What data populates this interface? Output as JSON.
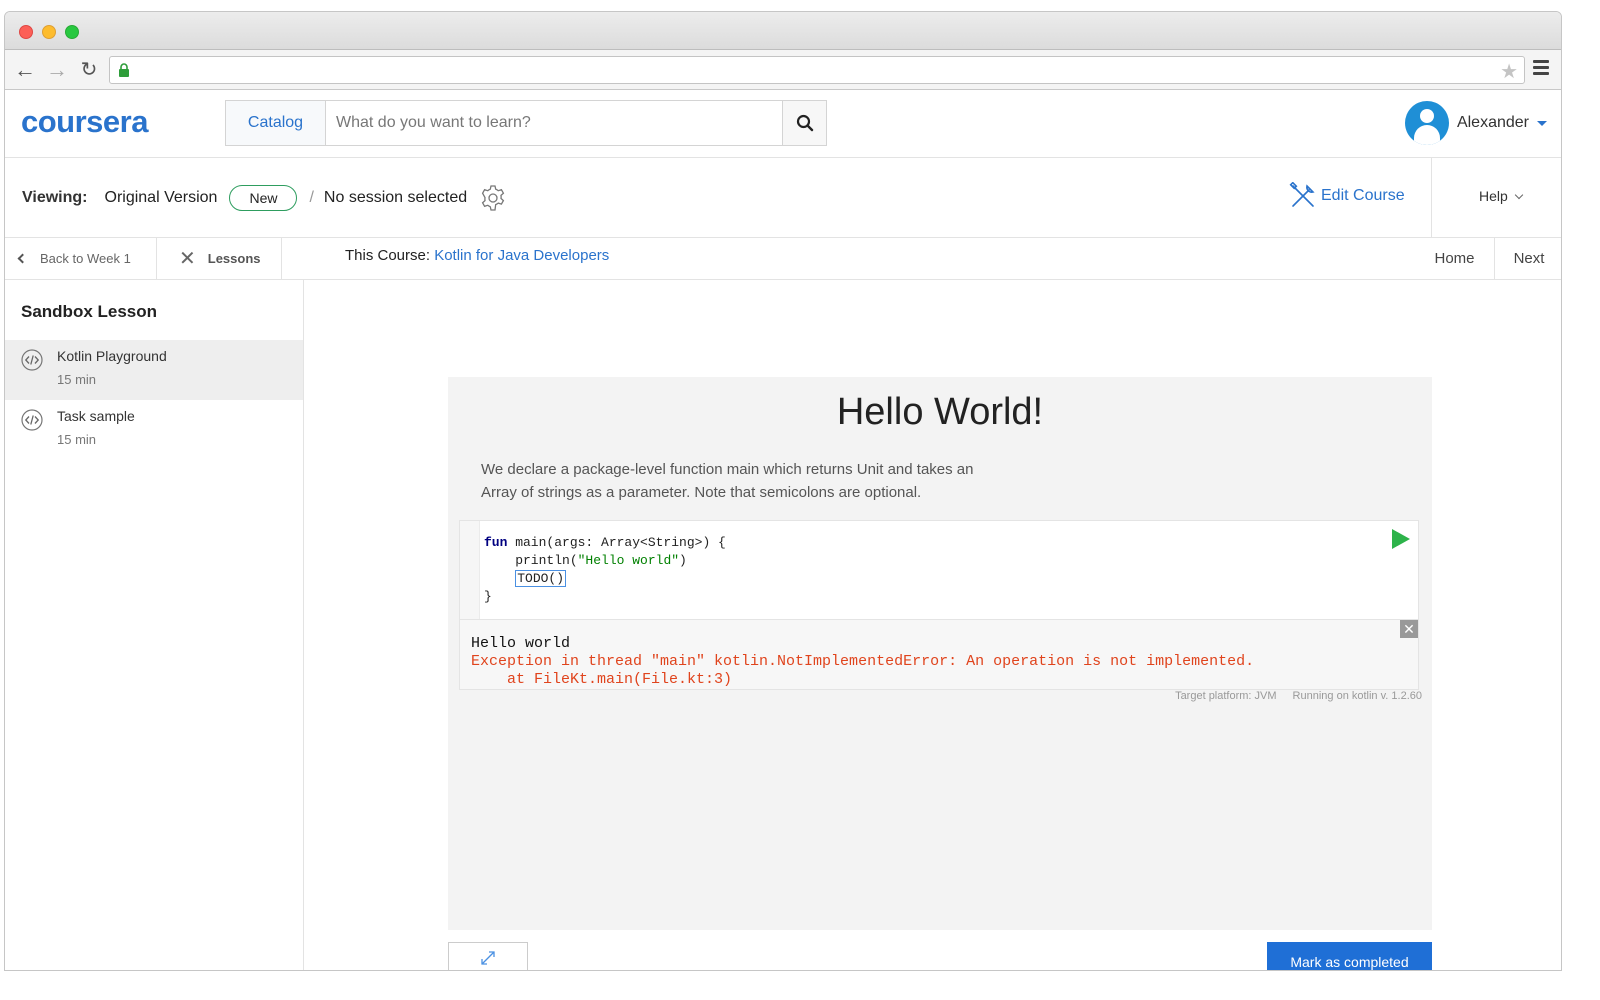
{
  "browser": {
    "url": ""
  },
  "header": {
    "logo": "coursera",
    "catalog_label": "Catalog",
    "search_placeholder": "What do you want to learn?",
    "user_name": "Alexander"
  },
  "viewing_bar": {
    "label": "Viewing:",
    "version": "Original Version",
    "new_badge": "New",
    "separator": "/",
    "session": "No session selected",
    "edit_course": "Edit Course",
    "help": "Help"
  },
  "lesson_nav": {
    "back": "Back to Week 1",
    "lessons": "Lessons",
    "course_prefix": "This Course:",
    "course_name": "Kotlin for Java Developers",
    "home": "Home",
    "next": "Next"
  },
  "sidebar": {
    "title": "Sandbox Lesson",
    "items": [
      {
        "name": "Kotlin Playground",
        "duration": "15 min",
        "active": true
      },
      {
        "name": "Task sample",
        "duration": "15 min",
        "active": false
      }
    ]
  },
  "lesson": {
    "title": "Hello World!",
    "description": "We declare a package-level function main which returns Unit and takes an Array of strings as a parameter. Note that semicolons are optional.",
    "code": {
      "line1_kw": "fun",
      "line1_rest": " main(args: Array<String>) {",
      "line2_pre": "    println(",
      "line2_str": "\"Hello world\"",
      "line2_post": ")",
      "line3_pre": "    ",
      "line3_todo": "TODO()",
      "line4": "}"
    },
    "output": {
      "line1": "Hello world",
      "line2": "Exception in thread \"main\" kotlin.NotImplementedError: An operation is not implemented.",
      "line3": "    at FileKt.main(File.kt:3)"
    },
    "target_platform": "Target platform: JVM",
    "running_on": "Running on kotlin v. 1.2.60",
    "mark_completed": "Mark as completed"
  },
  "colors": {
    "brand_blue": "#2a73cc",
    "run_green": "#2db34a",
    "error_red": "#e0441d",
    "button_blue": "#1f6fd6"
  }
}
